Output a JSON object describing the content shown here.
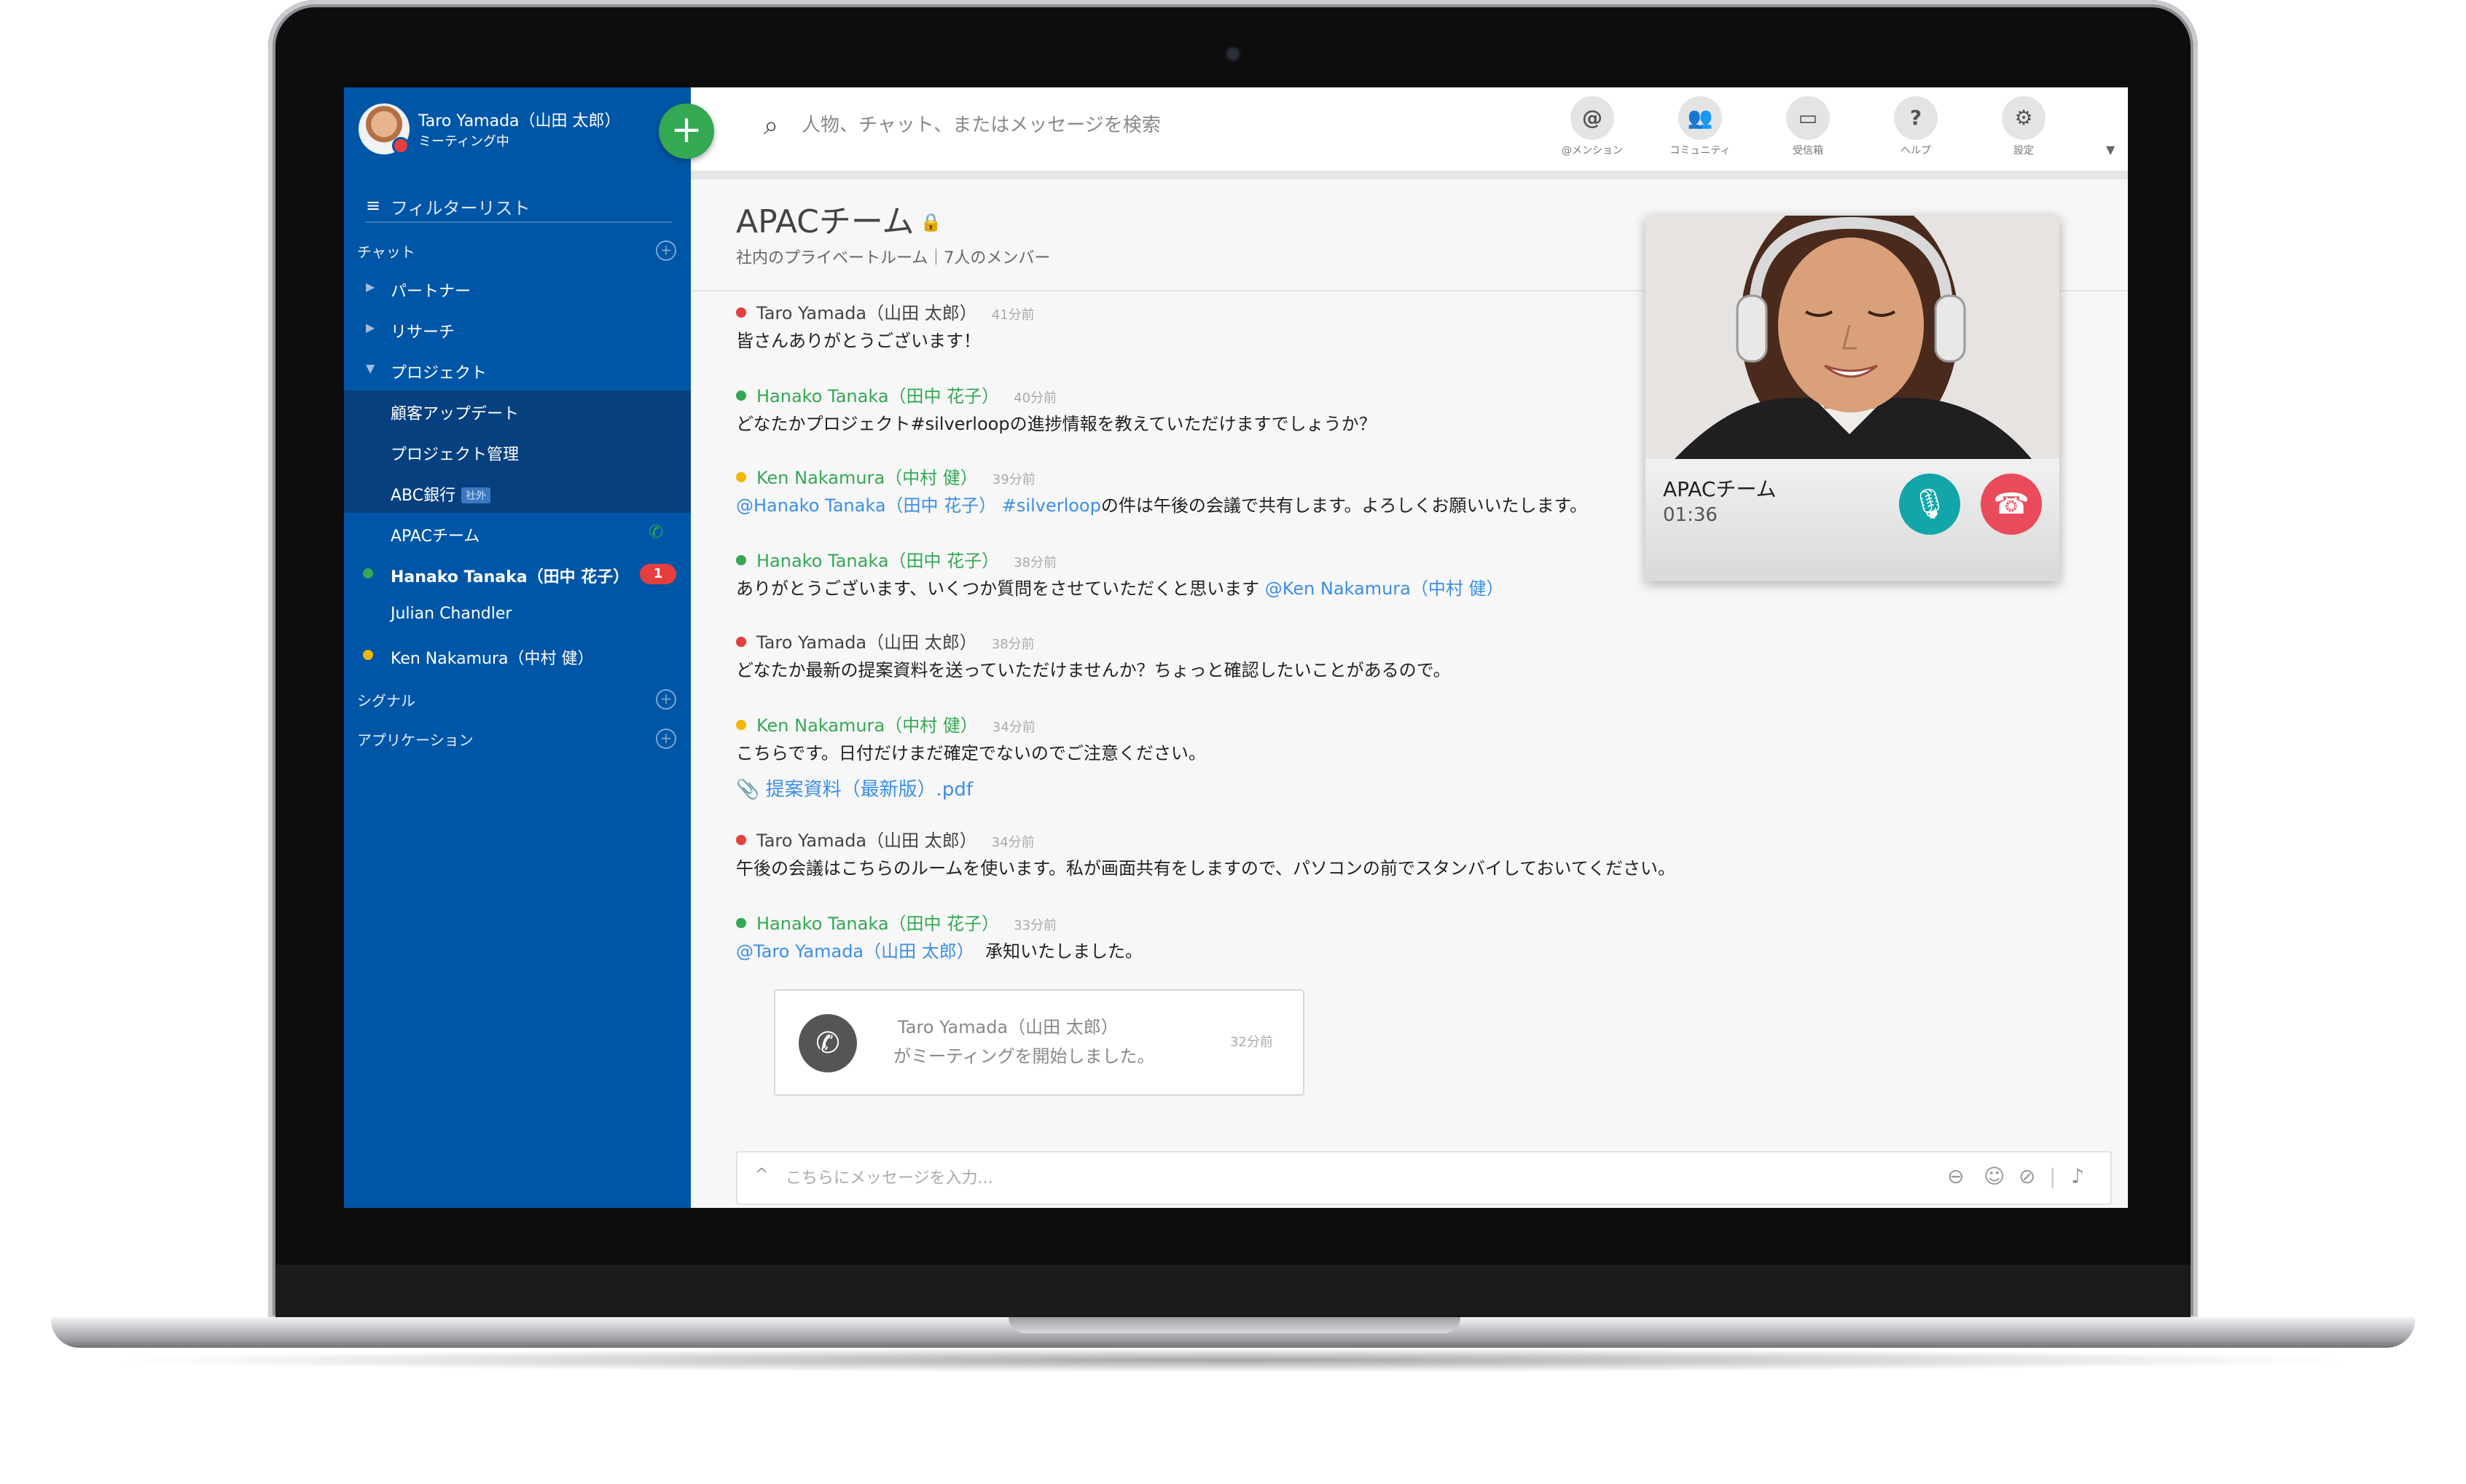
{
  "user": {
    "name": "Taro Yamada（山田 太郎）",
    "status": "ミーティング中"
  },
  "fab_label": "+",
  "sidebar": {
    "filter_label": "フィルターリスト",
    "sections": {
      "chat": "チャット",
      "signal": "シグナル",
      "apps": "アプリケーション"
    },
    "folders": [
      "パートナー",
      "リサーチ",
      "プロジェクト"
    ],
    "project_items": [
      "顧客アップデート",
      "プロジェクト管理",
      "ABC銀行",
      "APACチーム"
    ],
    "external_badge": "社外",
    "direct_messages": [
      "Hanako Tanaka（田中 花子）",
      "Julian Chandler",
      "Ken Nakamura（中村 健）"
    ],
    "unread_count": "1"
  },
  "search": {
    "placeholder": "人物、チャット、またはメッセージを検索"
  },
  "toolbar": {
    "mentions": "@メンション",
    "community": "コミュニティ",
    "inbox": "受信箱",
    "help": "ヘルプ",
    "settings": "設定"
  },
  "channel": {
    "title": "APACチーム",
    "subtitle": "社内のプライベートルーム｜7人のメンバー"
  },
  "messages": [
    {
      "name": "Taro Yamada（山田 太郎）",
      "time": "41分前",
      "text": "皆さんありがとうございます！"
    },
    {
      "name": "Hanako Tanaka（田中 花子）",
      "time": "40分前",
      "text": "どなたかプロジェクト#silverloopの進捗情報を教えていただけますでしょうか？"
    },
    {
      "name": "Ken Nakamura（中村 健）",
      "time": "39分前",
      "mention": "@Hanako Tanaka（田中 花子）",
      "tag": "#silverloop",
      "text": "の件は午後の会議で共有します。よろしくお願いいたします。"
    },
    {
      "name": "Hanako Tanaka（田中 花子）",
      "time": "38分前",
      "text": "ありがとうございます、いくつか質問をさせていただくと思います",
      "mention": "@Ken Nakamura（中村 健）"
    },
    {
      "name": "Taro Yamada（山田 太郎）",
      "time": "38分前",
      "text": "どなたか最新の提案資料を送っていただけませんか？ちょっと確認したいことがあるので。"
    },
    {
      "name": "Ken Nakamura（中村 健）",
      "time": "34分前",
      "text": "こちらです。日付だけまだ確定でないのでご注意ください。",
      "attachment": "提案資料（最新版）.pdf"
    },
    {
      "name": "Taro Yamada（山田 太郎）",
      "time": "34分前",
      "text": " 午後の会議はこちらのルームを使います。私が画面共有をしますので、パソコンの前でスタンバイしておいてください。"
    },
    {
      "name": "Hanako Tanaka（田中 花子）",
      "time": "33分前",
      "mention": "@Taro Yamada（山田 太郎）",
      "text": "承知いたしました。"
    }
  ],
  "call_card": {
    "name": "Taro Yamada（山田 太郎）",
    "desc": "がミーティングを開始しました。",
    "time": "32分前"
  },
  "composer": {
    "placeholder": "こちらにメッセージを入力..."
  },
  "video_call": {
    "title": "APACチーム",
    "duration": "01:36"
  },
  "colors": {
    "sidebar": "#0056a6",
    "accent_green": "#34a853",
    "mention_blue": "#3a8ee6",
    "alert_red": "#e53e3e",
    "mic_teal": "#12a5a9",
    "hangup_red": "#e94b5a"
  }
}
